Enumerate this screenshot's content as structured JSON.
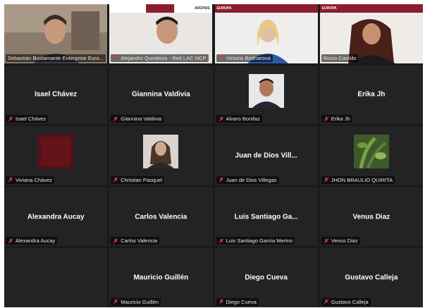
{
  "meeting": {
    "video_participants": [
      {
        "label": "Sebastián Bustamante Enterprise Euro...",
        "muted": false,
        "banner": ""
      },
      {
        "label": "Alejandro Quinteros - Red LAC NCP",
        "muted": true,
        "banner": "ARCHUS"
      },
      {
        "label": "Victoria Bodnarova",
        "muted": true,
        "banner": "EUROPA"
      },
      {
        "label": "Rocío Casildo",
        "muted": false,
        "banner": "EUROPA",
        "speaking": true
      }
    ],
    "participants": [
      {
        "center": "Isael Chávez",
        "label": "Isael Chávez"
      },
      {
        "center": "Giannina Valdivia",
        "label": "Giannina Valdivia"
      },
      {
        "center": "",
        "label": "Alvaro Bonifaz",
        "photo": "man-portrait"
      },
      {
        "center": "Erika Jh",
        "label": "Erika Jh"
      },
      {
        "center": "",
        "label": "Viviana Chávez",
        "photo": "dark-red-square"
      },
      {
        "center": "",
        "label": "Christian Pasquel",
        "photo": "long-hair-portrait"
      },
      {
        "center": "Juan de Dios Vill...",
        "label": "Juan de Dios Villegas"
      },
      {
        "center": "",
        "label": "JHON BRAULIO QUIRITA",
        "photo": "green-plant"
      },
      {
        "center": "Alexandra Aucay",
        "label": "Alexandra Aucay"
      },
      {
        "center": "Carlos Valencia",
        "label": "Carlos Valencia"
      },
      {
        "center": "Luis Santiago Ga...",
        "label": "Luis Santiago Garcia Merino"
      },
      {
        "center": "Venus Diaz",
        "label": "Venus Diaz"
      },
      {
        "center": "",
        "label": "",
        "empty": true
      },
      {
        "center": "Mauricio Guillén",
        "label": "Mauricio Guillén"
      },
      {
        "center": "Diego Cueva",
        "label": "Diego Cueva"
      },
      {
        "center": "Gustavo Calleja",
        "label": "Gustavo Calleja"
      }
    ]
  },
  "colors": {
    "muted_mic": "#e0383c",
    "speaking_border": "#c9d84a",
    "tile_bg": "#232323",
    "banner_red": "#8b1d2c"
  }
}
